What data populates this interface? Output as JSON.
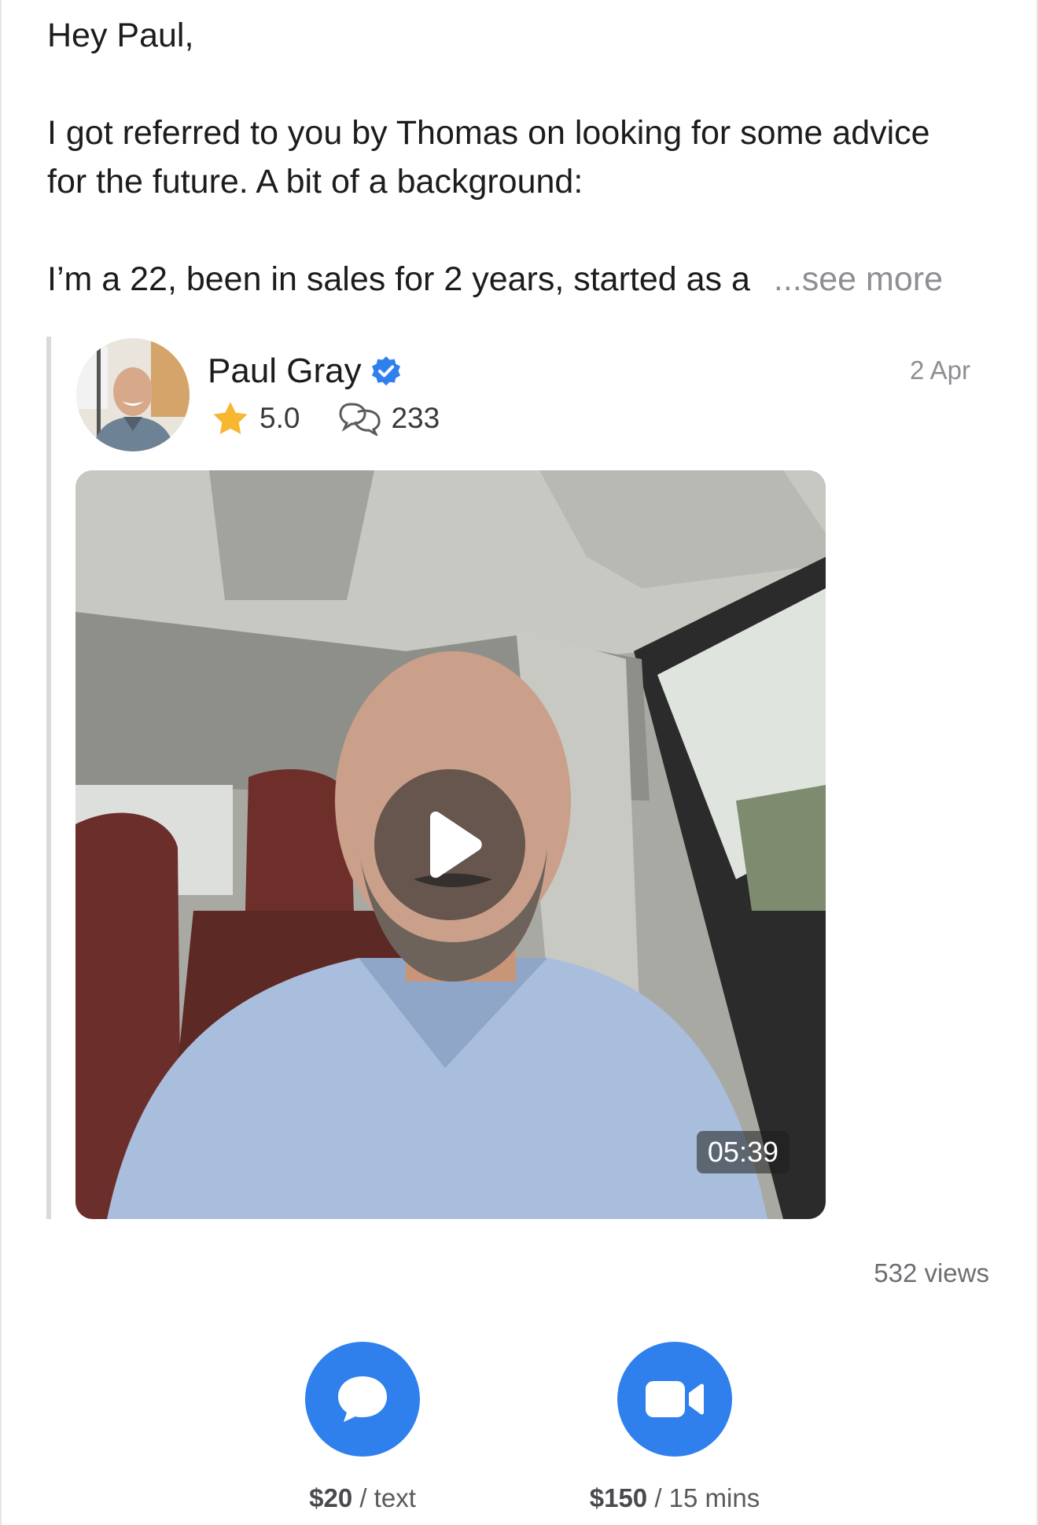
{
  "message": {
    "greeting": "Hey Paul,",
    "line1": "I got referred to you by Thomas on looking for some advice",
    "line2": "for the future. A bit of a background:",
    "line3": "I’m a 22, been in sales for 2 years, started as a",
    "see_more": "...see more"
  },
  "reply": {
    "author": "Paul Gray",
    "rating": "5.0",
    "replies_count": "233",
    "date": "2 Apr",
    "video": {
      "duration": "05:39"
    },
    "views": "532 views"
  },
  "actions": {
    "text": {
      "price": "$20",
      "unit": " / text",
      "icon": "chat-bubble-icon"
    },
    "video": {
      "price": "$150",
      "unit": " / 15 mins",
      "icon": "video-camera-icon"
    }
  },
  "colors": {
    "accent": "#2f80ed",
    "star": "#f7b731",
    "verified": "#2f80ed"
  }
}
